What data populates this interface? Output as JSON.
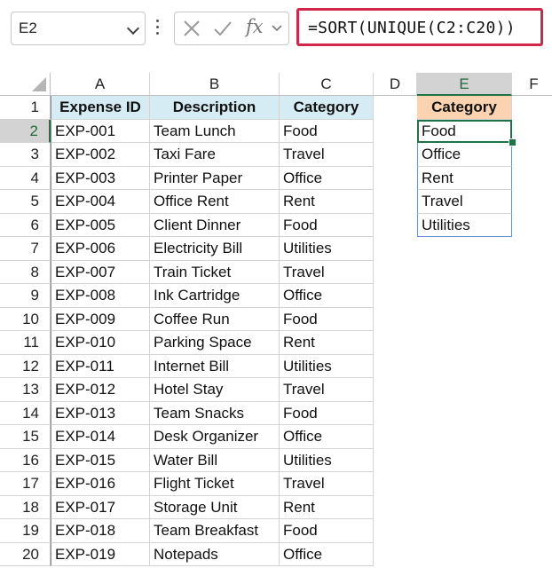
{
  "formula_bar": {
    "name_box": "E2",
    "formula": "=SORT(UNIQUE(C2:C20))",
    "fx_label": "fx"
  },
  "columns": [
    "A",
    "B",
    "C",
    "D",
    "E",
    "F"
  ],
  "table": {
    "headers": [
      "Expense ID",
      "Description",
      "Category"
    ],
    "rows": [
      [
        "EXP-001",
        "Team Lunch",
        "Food"
      ],
      [
        "EXP-002",
        "Taxi Fare",
        "Travel"
      ],
      [
        "EXP-003",
        "Printer Paper",
        "Office"
      ],
      [
        "EXP-004",
        "Office Rent",
        "Rent"
      ],
      [
        "EXP-005",
        "Client Dinner",
        "Food"
      ],
      [
        "EXP-006",
        "Electricity Bill",
        "Utilities"
      ],
      [
        "EXP-007",
        "Train Ticket",
        "Travel"
      ],
      [
        "EXP-008",
        "Ink Cartridge",
        "Office"
      ],
      [
        "EXP-009",
        "Coffee Run",
        "Food"
      ],
      [
        "EXP-010",
        "Parking Space",
        "Rent"
      ],
      [
        "EXP-011",
        "Internet Bill",
        "Utilities"
      ],
      [
        "EXP-012",
        "Hotel Stay",
        "Travel"
      ],
      [
        "EXP-013",
        "Team Snacks",
        "Food"
      ],
      [
        "EXP-014",
        "Desk Organizer",
        "Office"
      ],
      [
        "EXP-015",
        "Water Bill",
        "Utilities"
      ],
      [
        "EXP-016",
        "Flight Ticket",
        "Travel"
      ],
      [
        "EXP-017",
        "Storage Unit",
        "Rent"
      ],
      [
        "EXP-018",
        "Team Breakfast",
        "Food"
      ],
      [
        "EXP-019",
        "Notepads",
        "Office"
      ]
    ]
  },
  "result": {
    "header": "Category",
    "values": [
      "Food",
      "Office",
      "Rent",
      "Travel",
      "Utilities"
    ]
  },
  "row_numbers": [
    "1",
    "2",
    "3",
    "4",
    "5",
    "6",
    "7",
    "8",
    "9",
    "10",
    "11",
    "12",
    "13",
    "14",
    "15",
    "16",
    "17",
    "18",
    "19",
    "20"
  ],
  "colors": {
    "formula_highlight": "#d2254a",
    "header_fill": "#d6ecf5",
    "result_header_fill": "#fbd3b0",
    "selection": "#1f7346"
  }
}
